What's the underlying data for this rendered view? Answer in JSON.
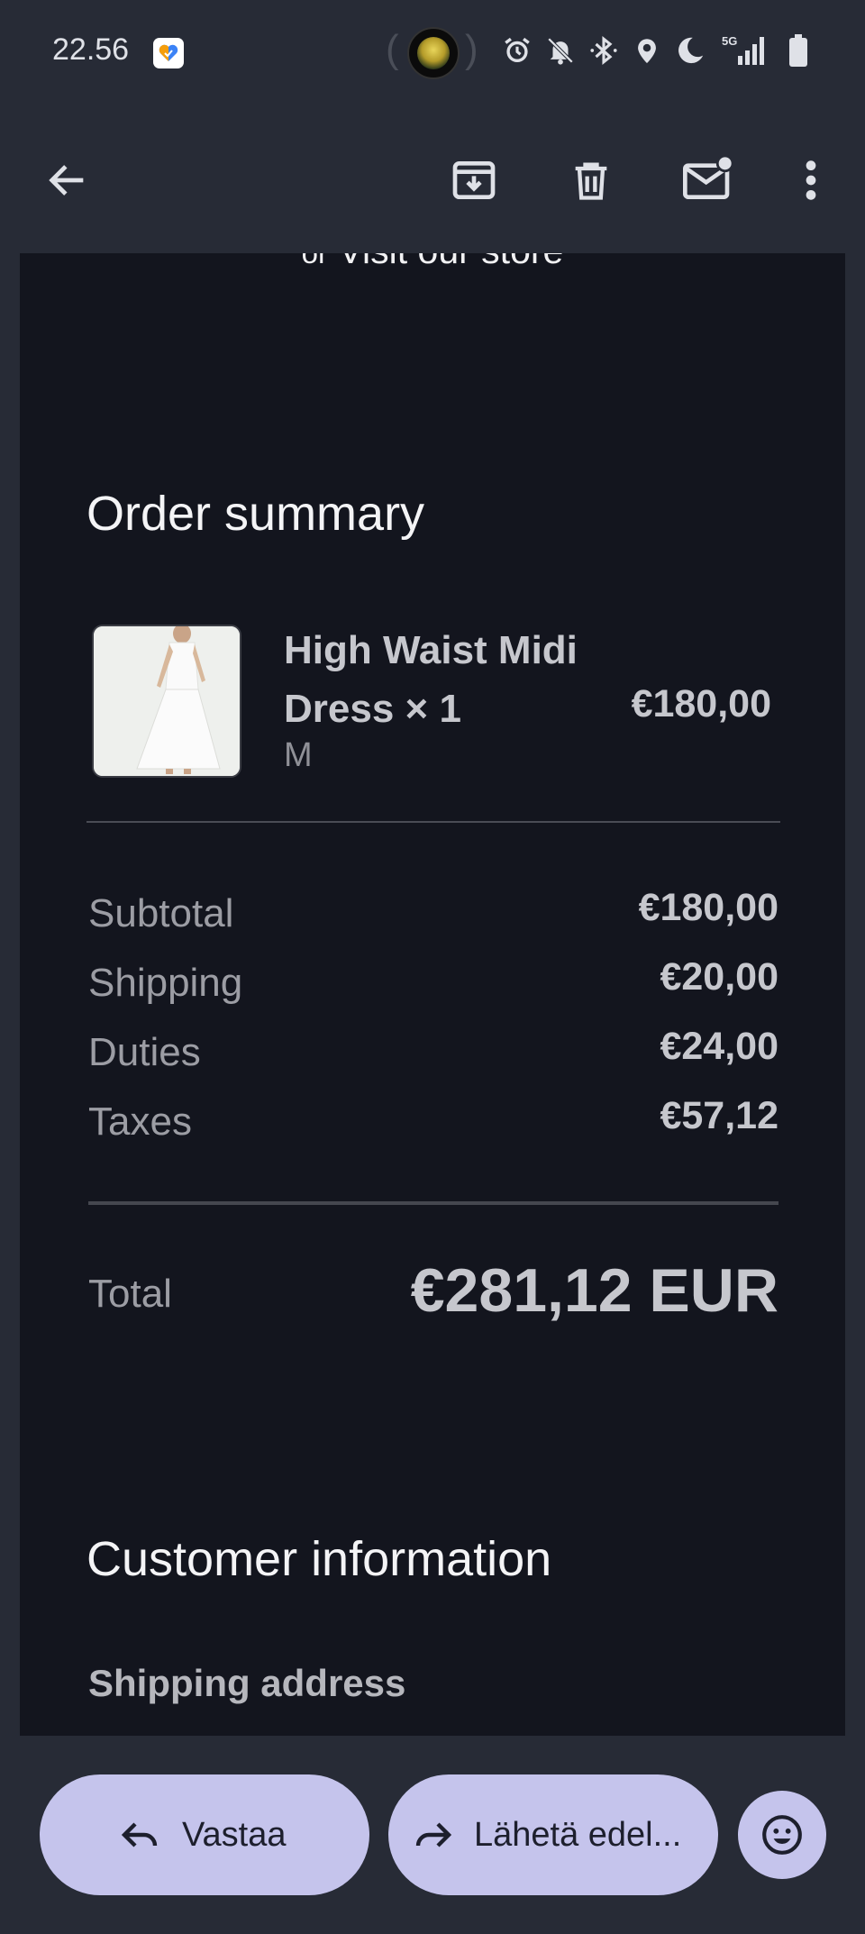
{
  "status_bar": {
    "time": "22.56",
    "icons": [
      "alarm-icon",
      "notifications-off-icon",
      "bluetooth-icon",
      "location-icon",
      "do-not-disturb-moon-icon",
      "signal-5g-icon",
      "battery-icon"
    ],
    "network_label": "5G"
  },
  "app_bar": {
    "icons": [
      "back-arrow-icon",
      "archive-icon",
      "delete-icon",
      "mark-unread-icon",
      "more-vert-icon"
    ]
  },
  "email": {
    "visit_prefix": "or",
    "visit_link": "Visit our store",
    "order_summary_title": "Order summary",
    "item": {
      "name": "High Waist Midi Dress × 1",
      "variant": "M",
      "price": "€180,00"
    },
    "summary_rows": [
      {
        "label": "Subtotal",
        "value": "€180,00"
      },
      {
        "label": "Shipping",
        "value": "€20,00"
      },
      {
        "label": "Duties",
        "value": "€24,00"
      },
      {
        "label": "Taxes",
        "value": "€57,12"
      }
    ],
    "total_label": "Total",
    "total_value": "€281,12 EUR",
    "customer_info_title": "Customer information",
    "shipping_address_label": "Shipping address"
  },
  "bottom_bar": {
    "reply_label": "Vastaa",
    "forward_label": "Lähetä edel...",
    "emoji_icon": "emoji-react-icon"
  },
  "colors": {
    "background": "#272b36",
    "email_surface": "#13151e",
    "pill": "#c5c4ec"
  }
}
